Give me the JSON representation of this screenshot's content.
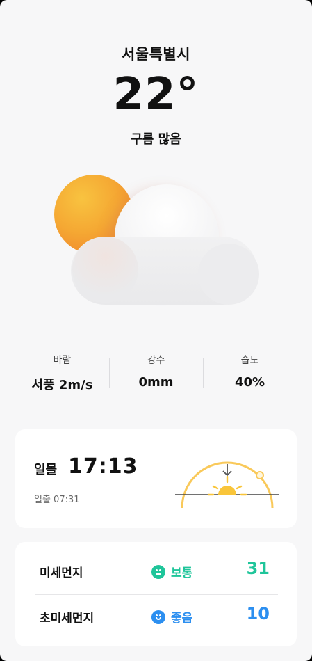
{
  "location": {
    "city": "서울특별시"
  },
  "current": {
    "temperature": "22°",
    "condition": "구름 많음"
  },
  "stats": [
    {
      "label": "바람",
      "value": "서풍 2m/s"
    },
    {
      "label": "강수",
      "value": "0mm"
    },
    {
      "label": "습도",
      "value": "40%"
    }
  ],
  "sun": {
    "sunset_label": "일몰",
    "sunset_time": "17:13",
    "sunrise_text": "일출 07:31"
  },
  "air_quality": [
    {
      "name": "미세먼지",
      "status": "보통",
      "value": "31",
      "color": "#1fc59a",
      "face": "neutral"
    },
    {
      "name": "초미세먼지",
      "status": "좋음",
      "value": "10",
      "color": "#2c8ff0",
      "face": "smile"
    }
  ],
  "colors": {
    "sun_arc": "#f9c95a",
    "horizon": "#444444",
    "background": "#f7f7f8"
  }
}
